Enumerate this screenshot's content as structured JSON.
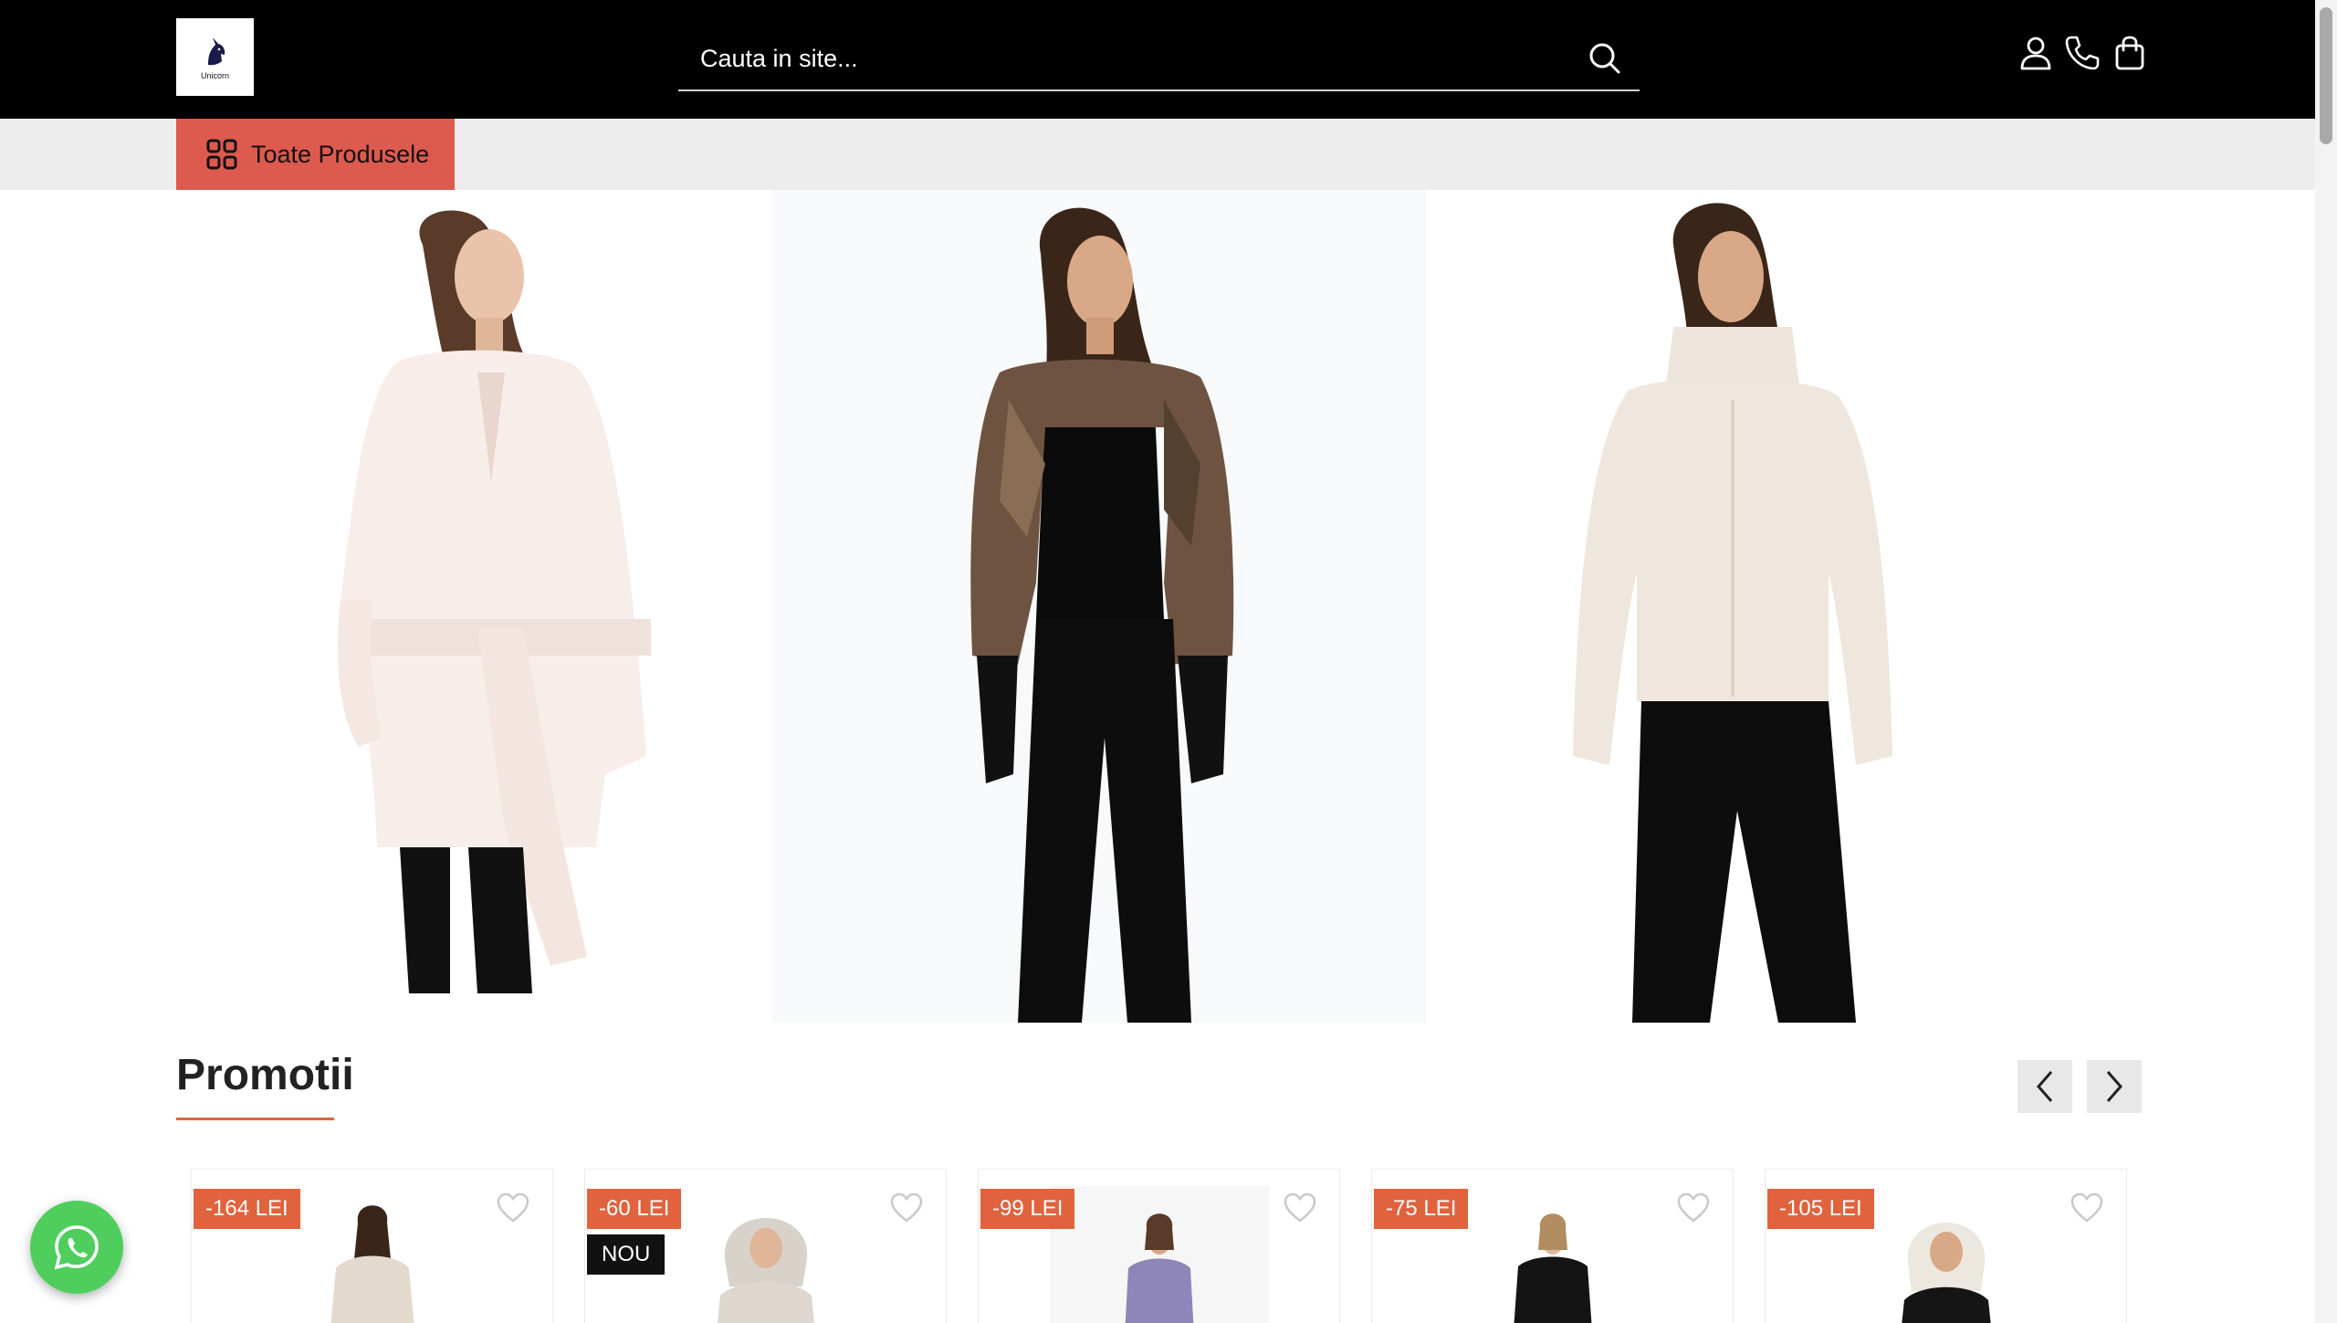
{
  "brand": {
    "logo_text": "Unicorn"
  },
  "search": {
    "placeholder": "Cauta in site..."
  },
  "header_icons": [
    "user-icon",
    "phone-icon",
    "shopping-bag-icon"
  ],
  "category_bar": {
    "all_products_label": "Toate Produsele",
    "accent_color": "#dd5a4e"
  },
  "hero": {
    "slides": [
      {
        "name": "white-belted-fur-coat"
      },
      {
        "name": "brown-fur-bolero"
      },
      {
        "name": "cream-fur-jacket"
      }
    ]
  },
  "promotions": {
    "title": "Promotii",
    "accent_color": "#e0633e",
    "cards": [
      {
        "discount": "-164 LEI",
        "new_label": ""
      },
      {
        "discount": "-60 LEI",
        "new_label": "NOU"
      },
      {
        "discount": "-99 LEI",
        "new_label": ""
      },
      {
        "discount": "-75 LEI",
        "new_label": ""
      },
      {
        "discount": "-105 LEI",
        "new_label": ""
      }
    ]
  },
  "whatsapp": {
    "color": "#4fce5d"
  }
}
